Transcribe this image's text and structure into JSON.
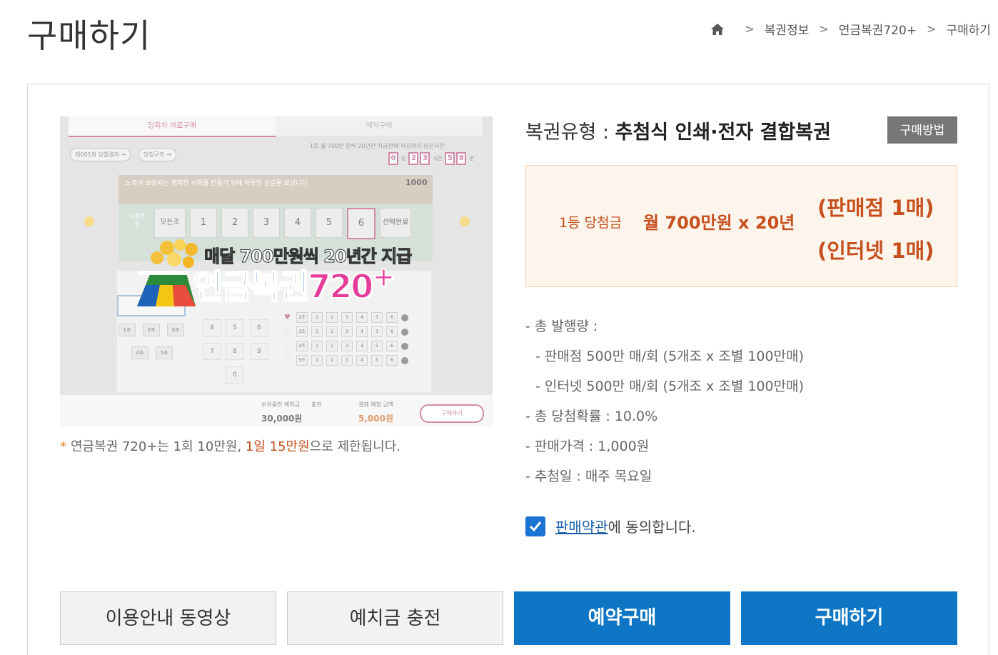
{
  "page": {
    "title": "구매하기"
  },
  "breadcrumb": {
    "items": [
      "복권정보",
      "연금복권720+",
      "구매하기"
    ]
  },
  "preview": {
    "tabs": [
      "당회차 바로구매",
      "예약구매"
    ],
    "chips": [
      "제001회 당첨결과 →",
      "당첨구조 →"
    ],
    "top_info": "1등 월 700만 원씩 20년간 지급",
    "remain_label": "판매 마감까지 남은시간",
    "digits": [
      "0",
      "2",
      "3",
      "5",
      "8"
    ],
    "digit_units": [
      "일",
      "시간",
      "분"
    ],
    "banner_text": "노후가 보장되는 행복한 사회를 만들기 위해 따뜻한 손길을 보냅니다",
    "amount": "1000",
    "auto_label": "자동번호",
    "num_row": [
      "모든조",
      "1",
      "2",
      "3",
      "4",
      "5",
      "6",
      "선택완료"
    ],
    "groups": [
      "1조",
      "2조",
      "3조",
      "4조",
      "5조"
    ],
    "keys": [
      "4",
      "5",
      "6",
      "7",
      "8",
      "9",
      "0"
    ],
    "row_labels": [
      "2조",
      "3조",
      "4조",
      "5조"
    ],
    "balance_label": "보유중인 예치금",
    "balance_value": "30,000원",
    "charge_label": "충전",
    "pay_label": "결제 예정 금액",
    "pay_value": "5,000원",
    "buy_label": "구매하기",
    "logo_sub": "매달 700만원씩 20년간 지급",
    "logo_main": "연금복권",
    "logo_num": "720",
    "logo_plus": "+"
  },
  "note": {
    "prefix": "연금복권 720+는 1회 10만원, ",
    "highlight": "1일 15만원",
    "suffix": "으로 제한됩니다."
  },
  "lottery_type": {
    "label": "복권유형 : ",
    "value": "추첨식 인쇄·전자 결합복권"
  },
  "how_button": "구매방법",
  "prize": {
    "label": "1등 당첨금",
    "amount": "월 700만원 x 20년",
    "store": "(판매점 1매)",
    "internet": "(인터넷 1매)"
  },
  "info": [
    "- 총 발행량 :",
    "- 판매점 500만 매/회 (5개조 x 조별 100만매)",
    "- 인터넷 500만 매/회 (5개조 x 조별 100만매)",
    "- 총 당첨확률 : 10.0%",
    "- 판매가격 : 1,000원",
    "- 추첨일 : 매주 목요일"
  ],
  "agree": {
    "link": "판매약관",
    "text": "에 동의합니다.",
    "checked": true
  },
  "buttons": {
    "guide": "이용안내 동영상",
    "charge": "예치금 충전",
    "reserve": "예약구매",
    "buy": "구매하기"
  },
  "colors": {
    "accent": "#c6511e",
    "primary_blue": "#0e76c4",
    "checkbox": "#1a73d3"
  }
}
